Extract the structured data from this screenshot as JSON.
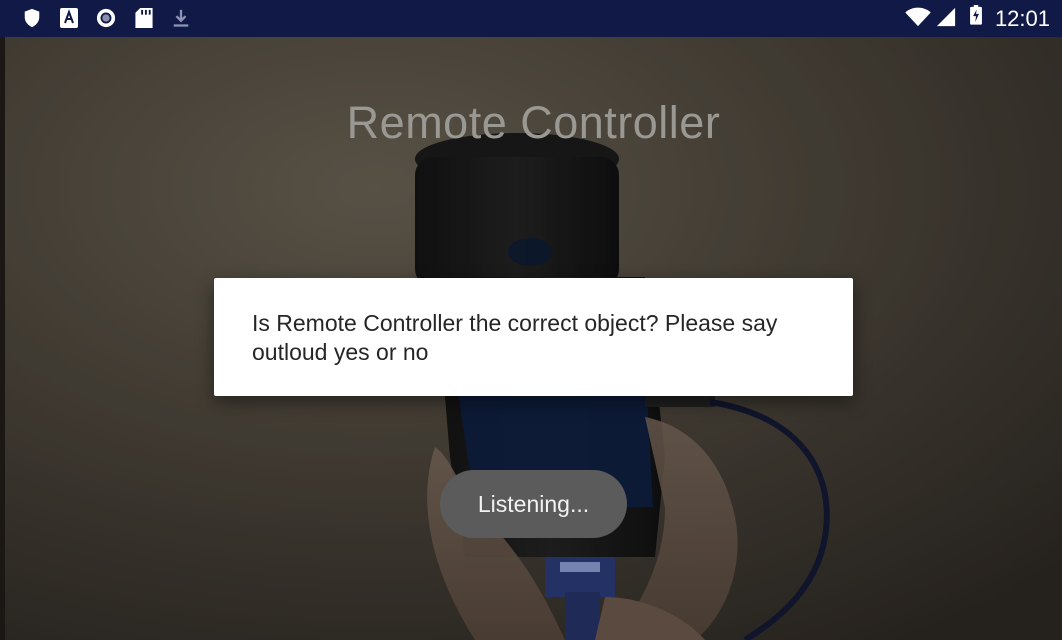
{
  "status_bar": {
    "time": "12:01",
    "left_icons": [
      "shield-icon",
      "a11y-font-icon",
      "circle-record-icon",
      "sd-card-icon",
      "download-icon"
    ],
    "right_icons": [
      "wifi-icon",
      "cell-signal-icon",
      "battery-charging-icon"
    ],
    "bg_color": "#111a47"
  },
  "app": {
    "title": "Remote Controller"
  },
  "dialog": {
    "message": "Is Remote Controller the correct object? Please say outloud yes or no"
  },
  "toast": {
    "text": "Listening..."
  }
}
